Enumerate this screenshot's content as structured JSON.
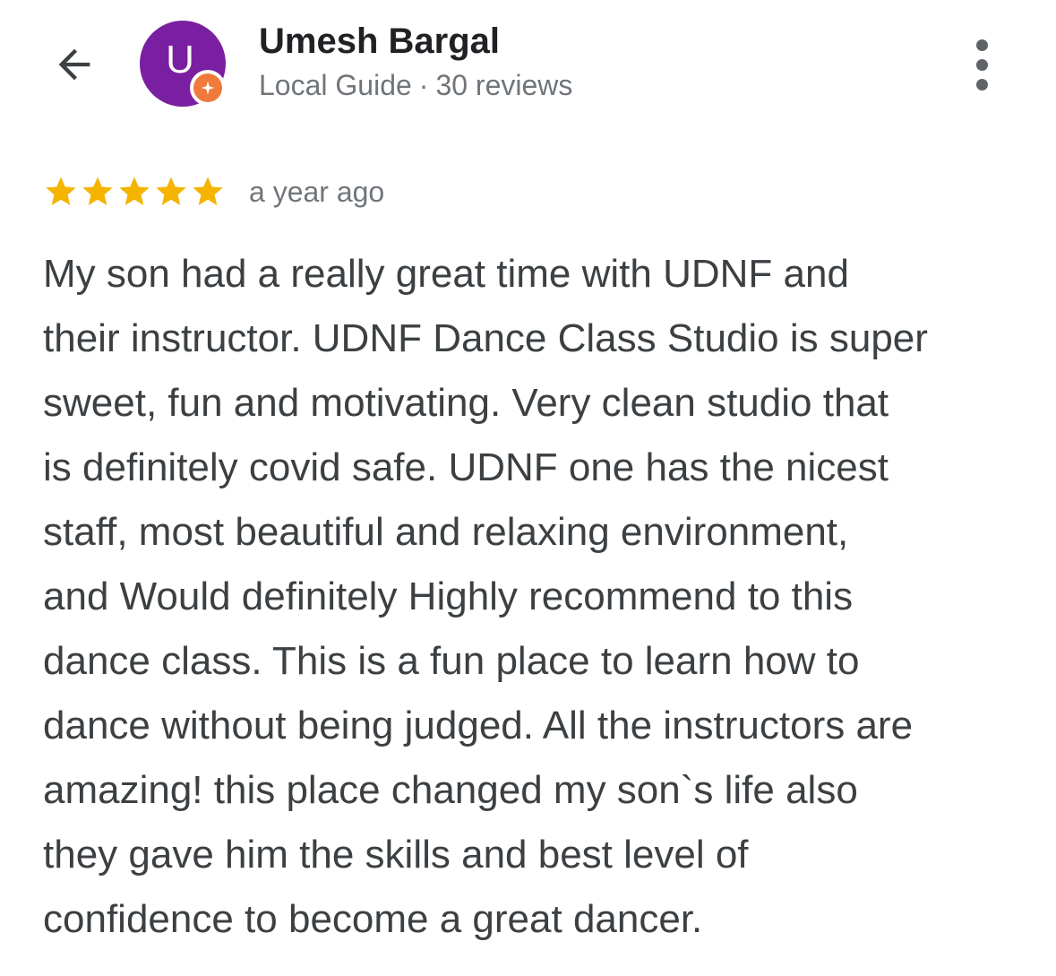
{
  "header": {
    "back_icon": "arrow-back-icon",
    "avatar_letter": "U",
    "avatar_color": "#7b1fa2",
    "badge_icon": "local-guide-badge-icon",
    "badge_color": "#f07a3b",
    "user_name": "Umesh Bargal",
    "guide_label": "Local Guide",
    "separator": "·",
    "reviews_count": "30 reviews",
    "more_icon": "more-vertical-icon"
  },
  "review": {
    "rating": 5,
    "max_rating": 5,
    "star_color": "#f4b400",
    "time": "a year ago",
    "lines": [
      "My son had a really great time with UDNF and",
      "their instructor. UDNF Dance Class Studio is super",
      "sweet, fun and motivating. Very clean studio that",
      "is definitely covid safe. UDNF one has the nicest",
      "staff, most beautiful and relaxing environment,",
      "and Would definitely Highly recommend to this",
      "dance class. This is a fun place to learn how to",
      "dance without being judged. All the instructors are",
      "amazing! this place changed my son`s life also",
      "they gave him the skills and best level of",
      "confidence to become a great dancer."
    ]
  }
}
